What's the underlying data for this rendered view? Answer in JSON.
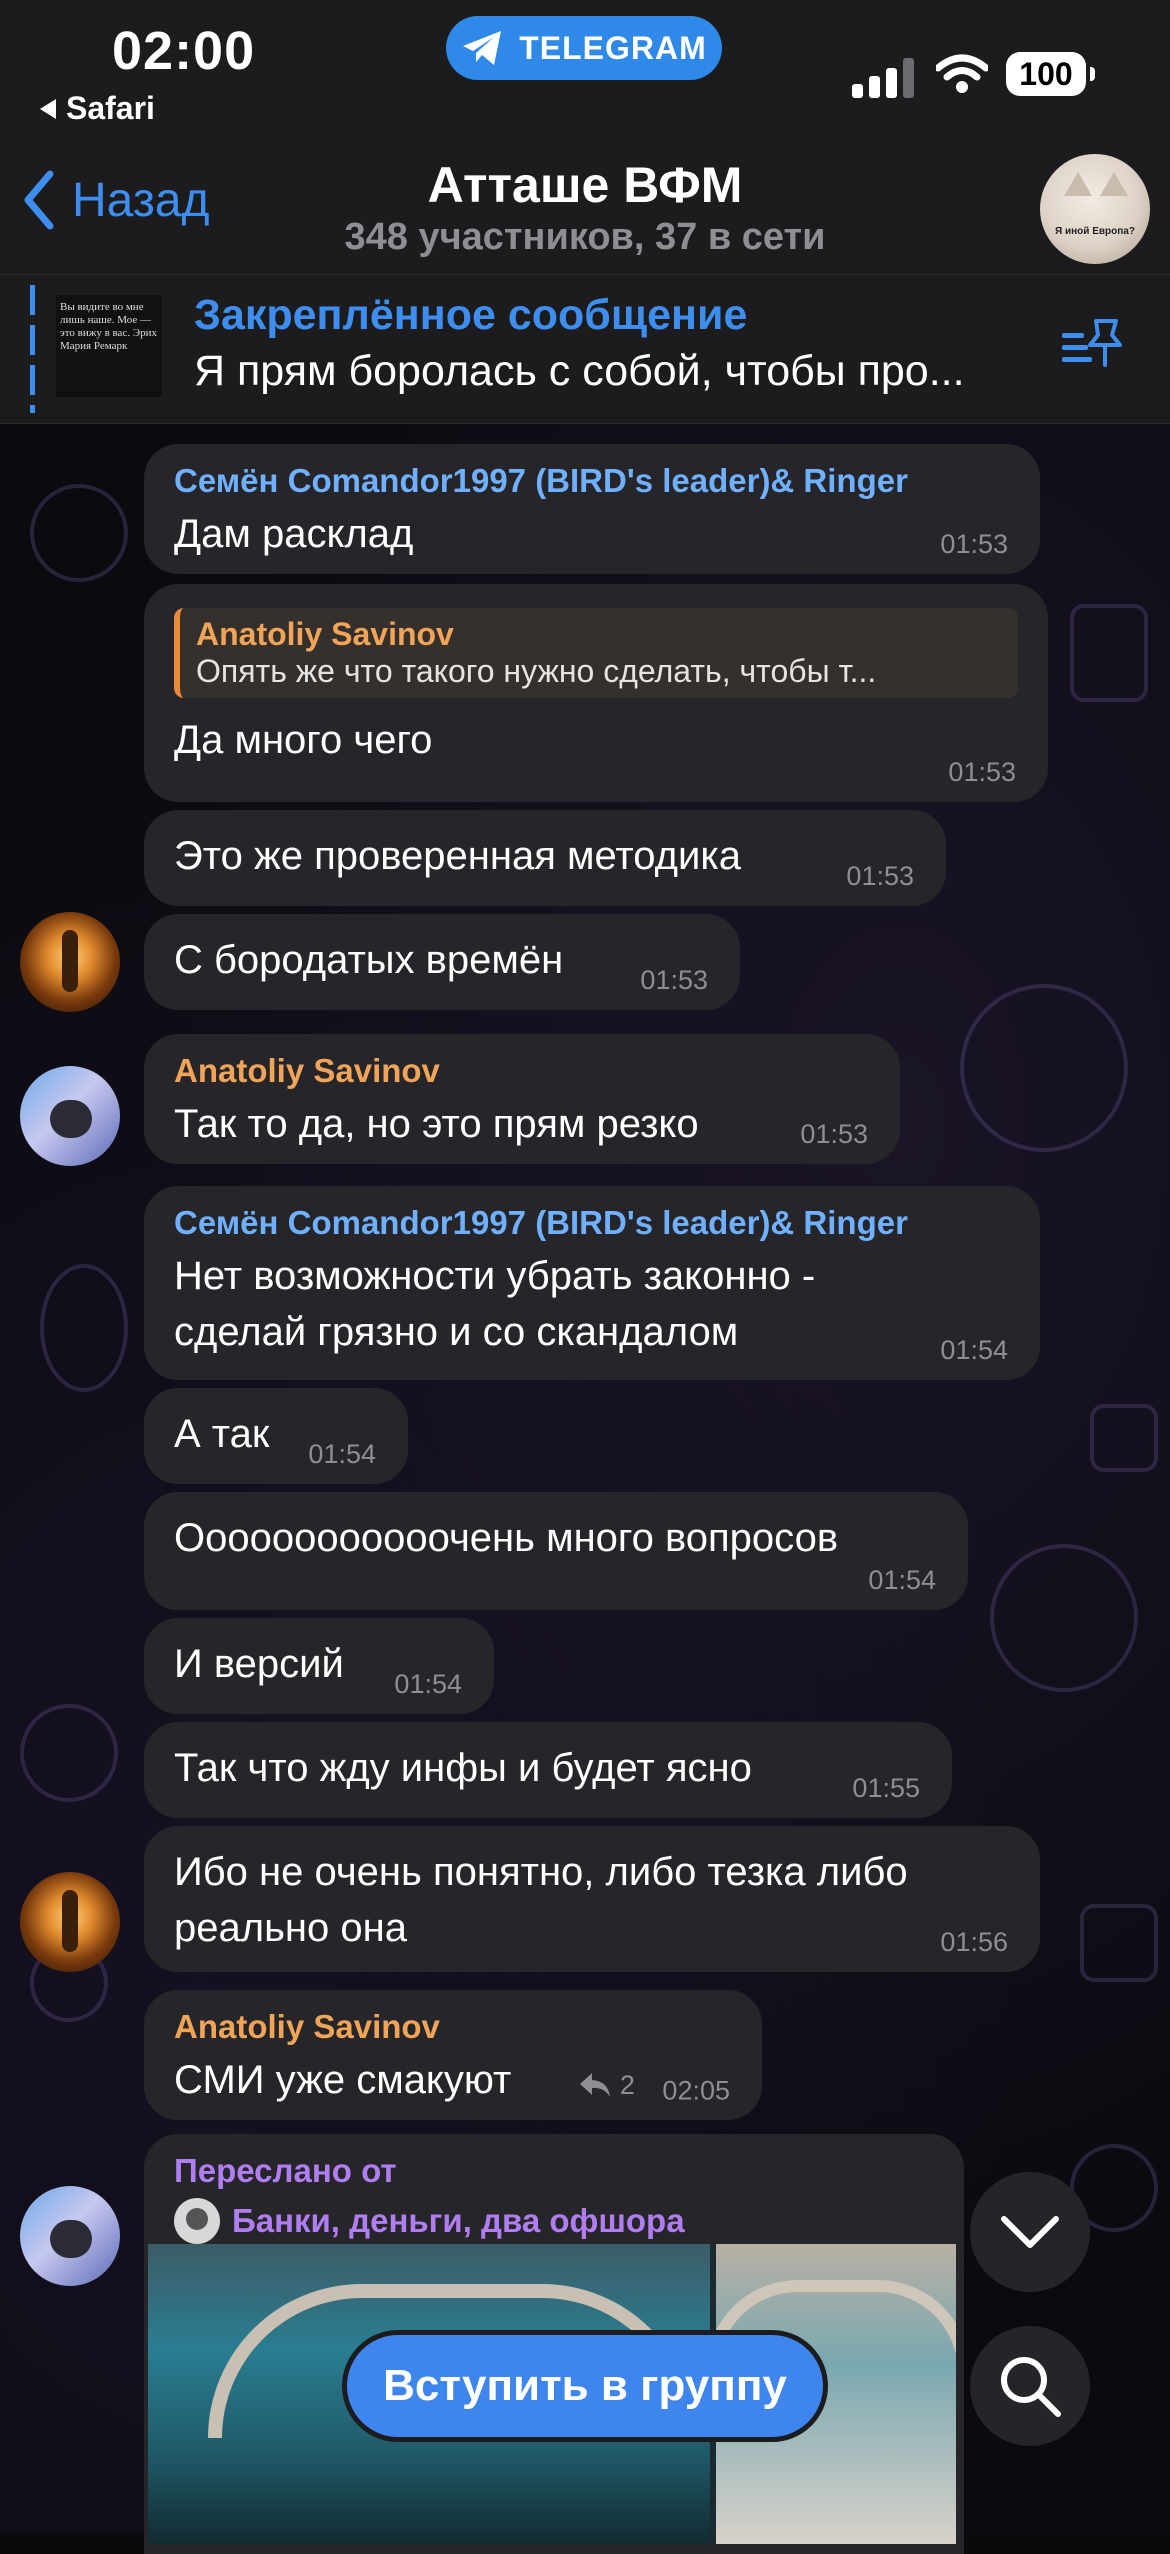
{
  "status_bar": {
    "time": "02:00",
    "back_app": "Safari",
    "telegram_pill": "TELEGRAM",
    "battery": "100"
  },
  "nav": {
    "back_label": "Назад",
    "title": "Атташе ВФМ",
    "subtitle": "348 участников, 37 в сети",
    "avatar_caption": "Я иной Европа?"
  },
  "pinned": {
    "title": "Закреплённое сообщение",
    "text": "Я прям боролась с собой, чтобы про...",
    "thumb_text": "Вы видите во мне лишь наше. Мое — это вижу в вас. Эрих Мария Ремарк"
  },
  "messages": [
    {
      "sender": "Семён Comandor1997 (BIRD's leader)& Ringer",
      "text": "Дам расклад",
      "time": "01:53"
    },
    {
      "reply_name": "Anatoliy Savinov",
      "reply_text": "Опять же что такого нужно сделать, чтобы т...",
      "text": "Да много чего",
      "time": "01:53"
    },
    {
      "text": "Это же проверенная методика",
      "time": "01:53"
    },
    {
      "text": "С бородатых времён",
      "time": "01:53"
    },
    {
      "sender": "Anatoliy Savinov",
      "text": "Так то да, но это прям резко",
      "time": "01:53"
    },
    {
      "sender": "Семён Comandor1997 (BIRD's leader)& Ringer",
      "text": "Нет возможности убрать законно - сделай грязно и со скандалом",
      "time": "01:54"
    },
    {
      "text": "А так",
      "time": "01:54"
    },
    {
      "text": "Оооооооооооочень много вопросов",
      "time": "01:54"
    },
    {
      "text": "И версий",
      "time": "01:54"
    },
    {
      "text": "Так что жду инфы и будет ясно",
      "time": "01:55"
    },
    {
      "text": "Ибо не очень понятно, либо тезка либо реально она",
      "time": "01:56"
    },
    {
      "sender": "Anatoliy Savinov",
      "text": "СМИ уже смакуют",
      "replies": "2",
      "time": "02:05"
    }
  ],
  "forwarded": {
    "label": "Переслано от",
    "source": "Банки, деньги, два офшора"
  },
  "join_button": "Вступить в группу",
  "colors": {
    "accent": "#3e8ef0",
    "sender_blue": "#6fb0ff",
    "sender_orange": "#f0a458",
    "forward_purple": "#b07ef0",
    "bubble": "#262529"
  }
}
